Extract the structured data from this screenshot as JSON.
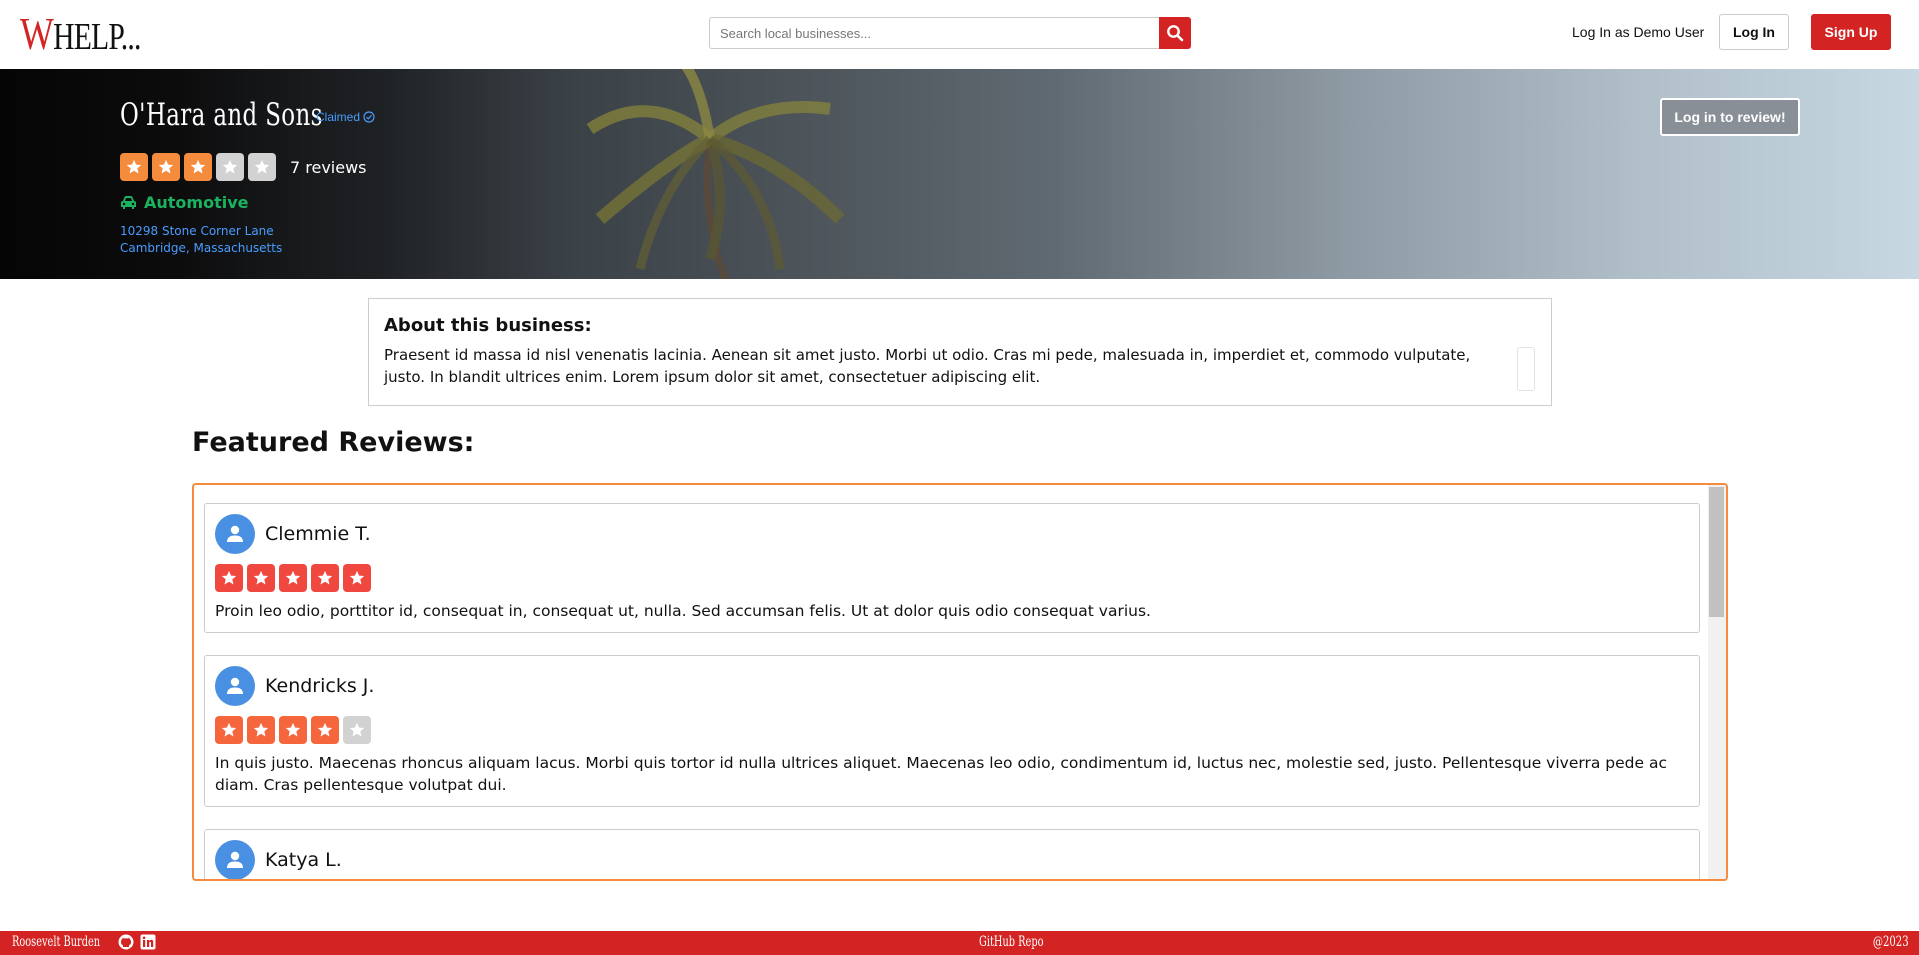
{
  "nav": {
    "logo_first": "W",
    "logo_rest": "HELP...",
    "search_placeholder": "Search local businesses...",
    "demo_label": "Log In as Demo User",
    "login_label": "Log In",
    "signup_label": "Sign Up",
    "search_icon": "search-icon"
  },
  "business": {
    "name": "O'Hara and Sons",
    "claimed_label": "Claimed",
    "rating": 3,
    "rating_max": 5,
    "reviews_label": "7 reviews",
    "category": "Automotive",
    "category_icon": "car-icon",
    "address_line1": "10298 Stone Corner Lane",
    "address_line2": "Cambridge, Massachusetts",
    "review_button": "Log in to review!"
  },
  "about": {
    "title": "About this business:",
    "text": "Praesent id massa id nisl venenatis lacinia. Aenean sit amet justo. Morbi ut odio. Cras mi pede, malesuada in, imperdiet et, commodo vulputate, justo. In blandit ultrices enim. Lorem ipsum dolor sit amet, consectetuer adipiscing elit."
  },
  "featured_title": "Featured Reviews:",
  "reviews": [
    {
      "name": "Clemmie T.",
      "rating": 5,
      "text": "Proin leo odio, porttitor id, consequat in, consequat ut, nulla. Sed accumsan felis. Ut at dolor quis odio consequat varius."
    },
    {
      "name": "Kendricks J.",
      "rating": 4,
      "text": "In quis justo. Maecenas rhoncus aliquam lacus. Morbi quis tortor id nulla ultrices aliquet. Maecenas leo odio, condimentum id, luctus nec, molestie sed, justo. Pellentesque viverra pede ac diam. Cras pellentesque volutpat dui."
    },
    {
      "name": "Katya L.",
      "rating": 0,
      "text": ""
    }
  ],
  "footer": {
    "author": "Roosevelt Burden",
    "repo": "GitHub Repo",
    "copyright": "@2023"
  },
  "colors": {
    "brand_red": "#d32323",
    "star_orange": "#f58b3c",
    "star_red": "#f0483e",
    "star_off": "#d2d2d2",
    "category_green": "#1bb35f",
    "link_blue": "#4a9cff"
  }
}
